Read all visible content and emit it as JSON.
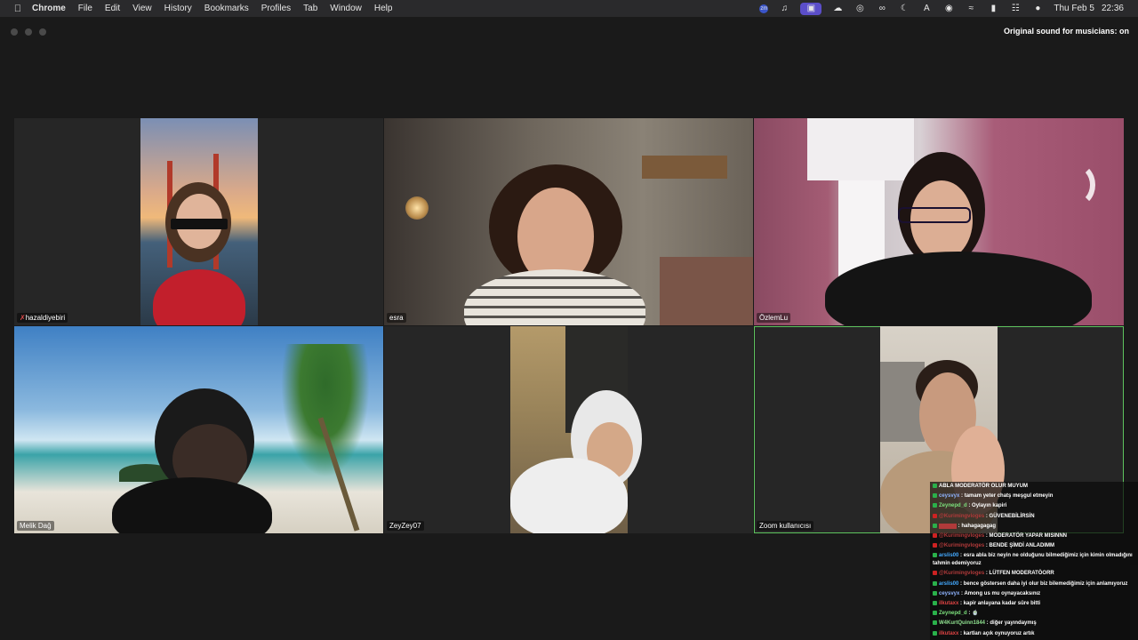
{
  "menubar": {
    "app_name": "Chrome",
    "items": [
      "File",
      "Edit",
      "View",
      "History",
      "Bookmarks",
      "Profiles",
      "Tab",
      "Window",
      "Help"
    ],
    "date": "Thu Feb 5",
    "time": "22:36",
    "tray_icons": [
      "zoom-icon",
      "sound-icon",
      "screen-share-icon",
      "cloud-icon",
      "vpn-icon",
      "link-icon",
      "moon-icon",
      "text-input-icon",
      "account-icon",
      "wifi-icon",
      "battery-icon",
      "control-center-icon",
      "siri-icon"
    ]
  },
  "window": {
    "sound_status": "Original sound for musicians: on"
  },
  "participants": [
    {
      "name": "hazaldiyebiri",
      "muted": true
    },
    {
      "name": "esra",
      "muted": false
    },
    {
      "name": "ÖzlemLu",
      "muted": false
    },
    {
      "name": "Melik Dağ",
      "muted": false
    },
    {
      "name": "ZeyZey07",
      "muted": false
    },
    {
      "name": "Zoom kullanıcısı",
      "muted": false,
      "active_speaker": true
    }
  ],
  "chat": [
    {
      "user": "",
      "text": "ABLA MODERATÖR OLUR MUYUM",
      "color": "#ffffff",
      "badge": "#2ab04a"
    },
    {
      "user": "ceysvyx",
      "text": "tamam yeter chatş meşgul etmeyin",
      "color": "#8fb4ff",
      "badge": "#2ab04a"
    },
    {
      "user": "Zeynepd_d",
      "text": "Oylayın kapiri",
      "color": "#7ce07c",
      "badge": "#2ab04a"
    },
    {
      "user": "@Kurimingvloges",
      "text": "GÜVENEBİLİRSİN",
      "color": "#b13a3a",
      "badge": "#cc2222"
    },
    {
      "user": "",
      "text": "hahagagagag",
      "color": "#b13a3a",
      "badge": "#2ab04a"
    },
    {
      "user": "@Kurimingvloges",
      "text": "MODERATÖR YAPAR MISINNN",
      "color": "#b13a3a",
      "badge": "#cc2222"
    },
    {
      "user": "@Kurimingvloges",
      "text": "BENDE ŞİMDİ ANLADIMM",
      "color": "#b13a3a",
      "badge": "#cc2222"
    },
    {
      "user": "arslis00",
      "text": "esra abla biz neyin ne olduğunu bilmediğimiz için kimin olmadığını tahmin edemiyoruz",
      "color": "#44aaff",
      "badge": "#2ab04a",
      "wrap": true
    },
    {
      "user": "@Kurimingvloges",
      "text": "LÜTFEN MODERATÖORR",
      "color": "#b13a3a",
      "badge": "#cc2222"
    },
    {
      "user": "arslis00",
      "text": "bence göstersen daha iyi olur biz bilemediğimiz için anlamıyoruz",
      "color": "#44aaff",
      "badge": "#2ab04a"
    },
    {
      "user": "ceysvyx",
      "text": "Among us mu oynayacaksınız",
      "color": "#8fb4ff",
      "badge": "#2ab04a"
    },
    {
      "user": "ilkutaxx",
      "text": "kapir anlayana kadar süre bitti",
      "color": "#e04444",
      "badge": "#2ab04a"
    },
    {
      "user": "Zeynepd_d",
      "text": "🍵",
      "color": "#7ce07c",
      "badge": "#2ab04a"
    },
    {
      "user": "W4KurtQuinn1844",
      "text": "diğer yayındaymış",
      "color": "#8fe08f",
      "badge": "#2ab04a"
    },
    {
      "user": "ilkutaxx",
      "text": "kartları açık oynuyoruz artık",
      "color": "#e04444",
      "badge": "#2ab04a"
    }
  ]
}
